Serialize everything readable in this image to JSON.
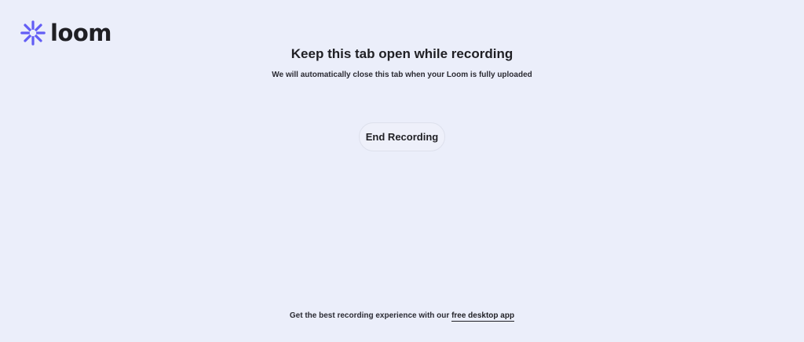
{
  "brand": {
    "name": "loom",
    "logo_icon": "loom-burst-icon",
    "accent_color": "#625df5"
  },
  "main": {
    "title": "Keep this tab open while recording",
    "subtitle": "We will automatically close this tab when your Loom is fully uploaded",
    "end_button_label": "End Recording"
  },
  "footer": {
    "prefix": "Get the best recording experience with our",
    "link_text": "free desktop app"
  },
  "colors": {
    "background": "#ebeefa",
    "text": "#1f1f24"
  }
}
